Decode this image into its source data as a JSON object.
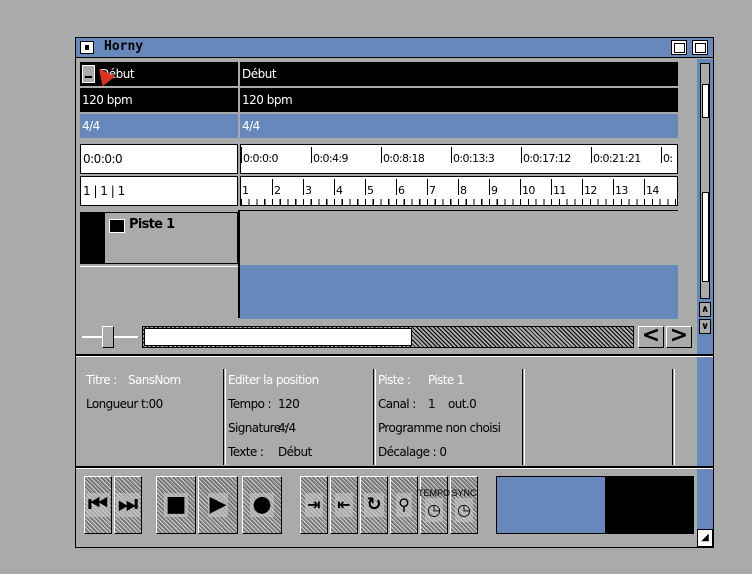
{
  "window": {
    "title": "Horny"
  },
  "header_rows": {
    "event": {
      "left": "Début",
      "right": "Début"
    },
    "tempo": {
      "left": "120 bpm",
      "right": "120 bpm"
    },
    "signature": {
      "left": "4/4",
      "right": "4/4"
    },
    "time": {
      "left": "0:0:0:0",
      "ruler": [
        "0:0:0:0",
        "0:0:4:9",
        "0:0:8:18",
        "0:0:13:3",
        "0:0:17:12",
        "0:0:21:21",
        "0:"
      ]
    },
    "measure": {
      "left": "1 | 1 | 1",
      "ruler": [
        "1",
        "2",
        "3",
        "4",
        "5",
        "6",
        "7",
        "8",
        "9",
        "10",
        "11",
        "12",
        "13",
        "14"
      ]
    }
  },
  "tracks": [
    {
      "name": "Piste 1"
    }
  ],
  "info": {
    "col1": {
      "title_label": "Titre :",
      "title_value": "SansNom",
      "length": "Longueur t:00"
    },
    "col2": {
      "heading": "Editer la position",
      "tempo_label": "Tempo :",
      "tempo_value": "120",
      "signature_label": "Signature :",
      "signature_value": "4/4",
      "text_label": "Texte :",
      "text_value": "Début"
    },
    "col3": {
      "piste_label": "Piste :",
      "piste_value": "Piste 1",
      "canal_label": "Canal :",
      "canal_value": "1",
      "out_value": "out.0",
      "program": "Programme non choisi",
      "offset": "Décalage : 0"
    }
  },
  "scroll": {
    "prev_label": "<",
    "next_label": ">"
  },
  "transport": {
    "rewind_icon": "rewind-icon",
    "forward_icon": "forward-icon",
    "stop_icon": "stop-icon",
    "play_icon": "play-icon",
    "record_icon": "record-icon",
    "punch_in_icon": "punch-in-icon",
    "punch_out_icon": "punch-out-icon",
    "loop_icon": "loop-icon",
    "step_icon": "step-icon",
    "tempo_label": "TEMPO",
    "sync_label": "SYNC"
  },
  "meter": {
    "level": 0.55
  },
  "colors": {
    "accent": "#6688bb",
    "background": "#aaaaaa",
    "dark": "#000000",
    "light": "#ffffff"
  }
}
